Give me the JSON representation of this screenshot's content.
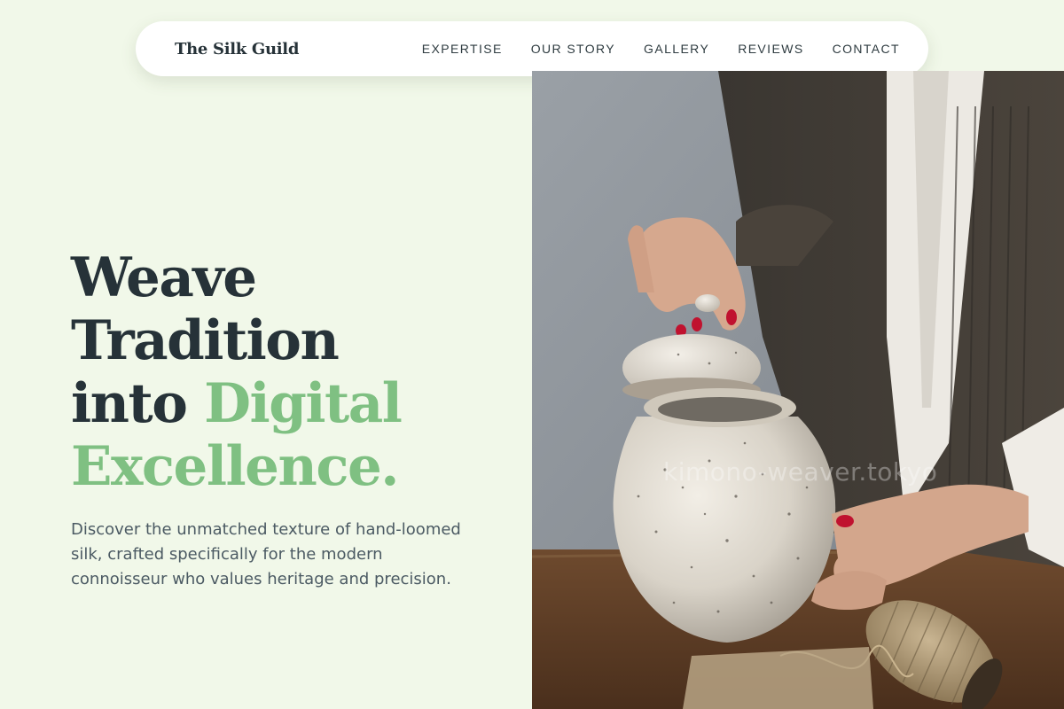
{
  "brand": {
    "name": "The Silk Guild"
  },
  "nav": {
    "links": [
      {
        "label": "EXPERTISE"
      },
      {
        "label": "OUR STORY"
      },
      {
        "label": "GALLERY"
      },
      {
        "label": "REVIEWS"
      },
      {
        "label": "CONTACT"
      }
    ]
  },
  "hero": {
    "headline": {
      "line1": "Weave",
      "line2": "Tradition",
      "line3_plain": "into",
      "line3_accent": "Digital",
      "line4_accent": "Excellence."
    },
    "subtitle": "Discover the unmatched texture of hand-loomed silk, crafted specifically for the modern connoisseur who values heritage and precision.",
    "image": {
      "subject": "Hands lifting the lid of a speckled white ceramic jar, with a spool of twine on a wooden table",
      "watermark": "kimono-weaver.tokyo"
    }
  },
  "colors": {
    "background": "#f1f8e9",
    "accent": "#7fc082",
    "text_dark": "#263238",
    "text_muted": "#4b5a63"
  }
}
